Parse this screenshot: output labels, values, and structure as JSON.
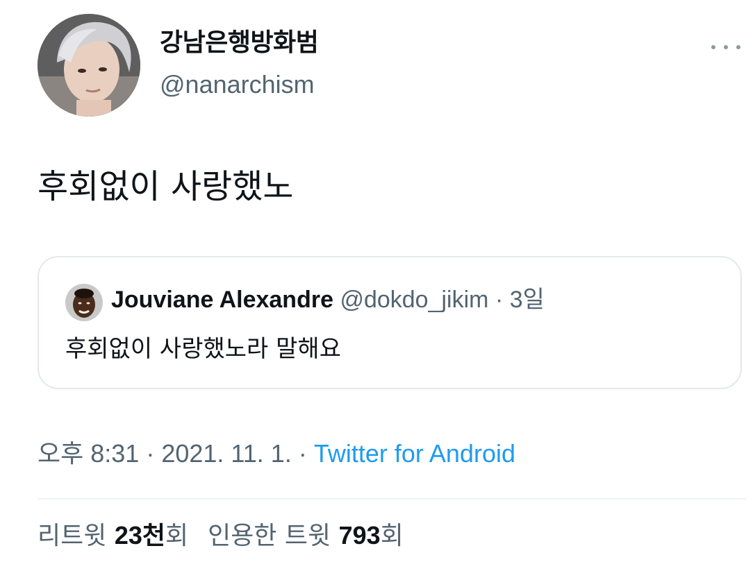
{
  "author": {
    "display_name": "강남은행방화범",
    "handle": "@nanarchism"
  },
  "tweet": {
    "text": "후회없이 사랑했노"
  },
  "quoted_tweet": {
    "display_name": "Jouviane Alexandre",
    "handle": "@dokdo_jikim",
    "separator": "·",
    "time": "3일",
    "text": "후회없이 사랑했노라 말해요"
  },
  "meta": {
    "time": "오후 8:31",
    "date": "2021. 11. 1.",
    "separator": "·",
    "source": "Twitter for Android"
  },
  "stats": {
    "retweets_label": "리트윗",
    "retweets_count": "23",
    "retweets_unit": "천",
    "retweets_suffix": "회",
    "quotes_label": "인용한 트윗",
    "quotes_count": "793",
    "quotes_suffix": "회"
  },
  "icons": {
    "more": "more-horizontal-icon"
  },
  "colors": {
    "text_primary": "#0f1419",
    "text_secondary": "#536471",
    "link": "#1d9bf0",
    "border": "#e3e8ec"
  }
}
